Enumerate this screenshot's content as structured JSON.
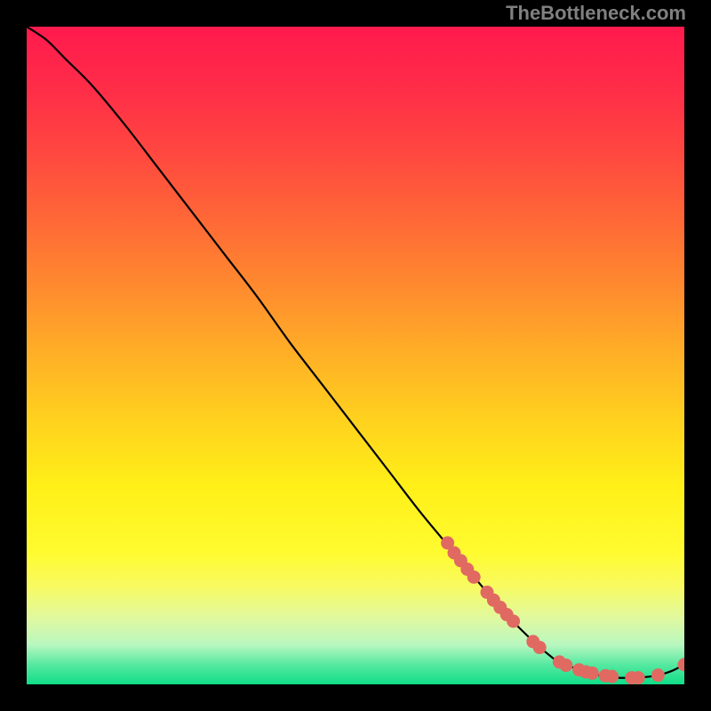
{
  "attribution": "TheBottleneck.com",
  "colors": {
    "gradient_stops": [
      {
        "offset": 0.0,
        "color": "#ff1a4d"
      },
      {
        "offset": 0.1,
        "color": "#ff2e48"
      },
      {
        "offset": 0.2,
        "color": "#ff4a3f"
      },
      {
        "offset": 0.3,
        "color": "#ff6a36"
      },
      {
        "offset": 0.4,
        "color": "#ff8c2e"
      },
      {
        "offset": 0.5,
        "color": "#ffb026"
      },
      {
        "offset": 0.6,
        "color": "#ffd21e"
      },
      {
        "offset": 0.7,
        "color": "#fff018"
      },
      {
        "offset": 0.8,
        "color": "#fffb30"
      },
      {
        "offset": 0.85,
        "color": "#f8fa60"
      },
      {
        "offset": 0.9,
        "color": "#e0f9a0"
      },
      {
        "offset": 0.94,
        "color": "#b8f7c0"
      },
      {
        "offset": 0.97,
        "color": "#56e9a0"
      },
      {
        "offset": 1.0,
        "color": "#10dd88"
      }
    ],
    "curve": "#000000",
    "marker_fill": "#e06a62",
    "marker_stroke": "#c25850"
  },
  "chart_data": {
    "type": "line",
    "title": "",
    "xlabel": "",
    "ylabel": "",
    "xlim": [
      0,
      100
    ],
    "ylim": [
      0,
      100
    ],
    "series": [
      {
        "name": "bottleneck-curve",
        "x": [
          0,
          3,
          6,
          10,
          15,
          20,
          25,
          30,
          35,
          40,
          45,
          50,
          55,
          60,
          65,
          70,
          75,
          80,
          82,
          84,
          86,
          88,
          90,
          92,
          94,
          96,
          98,
          100
        ],
        "y": [
          100,
          98,
          95,
          91,
          85,
          78.5,
          72,
          65.5,
          59,
          52,
          45.5,
          39,
          32.5,
          26,
          20,
          14,
          8.5,
          4,
          3,
          2.2,
          1.6,
          1.2,
          1.0,
          1.0,
          1.1,
          1.4,
          2.0,
          3.0
        ]
      }
    ],
    "markers": {
      "name": "data-points",
      "points": [
        {
          "x": 64,
          "y": 21.5
        },
        {
          "x": 65,
          "y": 20.0
        },
        {
          "x": 66,
          "y": 18.8
        },
        {
          "x": 67,
          "y": 17.5
        },
        {
          "x": 68,
          "y": 16.3
        },
        {
          "x": 70,
          "y": 14.0
        },
        {
          "x": 71,
          "y": 12.8
        },
        {
          "x": 72,
          "y": 11.7
        },
        {
          "x": 73,
          "y": 10.6
        },
        {
          "x": 74,
          "y": 9.6
        },
        {
          "x": 77,
          "y": 6.5
        },
        {
          "x": 78,
          "y": 5.6
        },
        {
          "x": 81,
          "y": 3.4
        },
        {
          "x": 82,
          "y": 2.9
        },
        {
          "x": 84,
          "y": 2.2
        },
        {
          "x": 85,
          "y": 1.9
        },
        {
          "x": 86,
          "y": 1.7
        },
        {
          "x": 88,
          "y": 1.3
        },
        {
          "x": 89,
          "y": 1.2
        },
        {
          "x": 92,
          "y": 1.0
        },
        {
          "x": 93,
          "y": 1.0
        },
        {
          "x": 96,
          "y": 1.4
        },
        {
          "x": 100,
          "y": 3.0
        }
      ]
    }
  }
}
